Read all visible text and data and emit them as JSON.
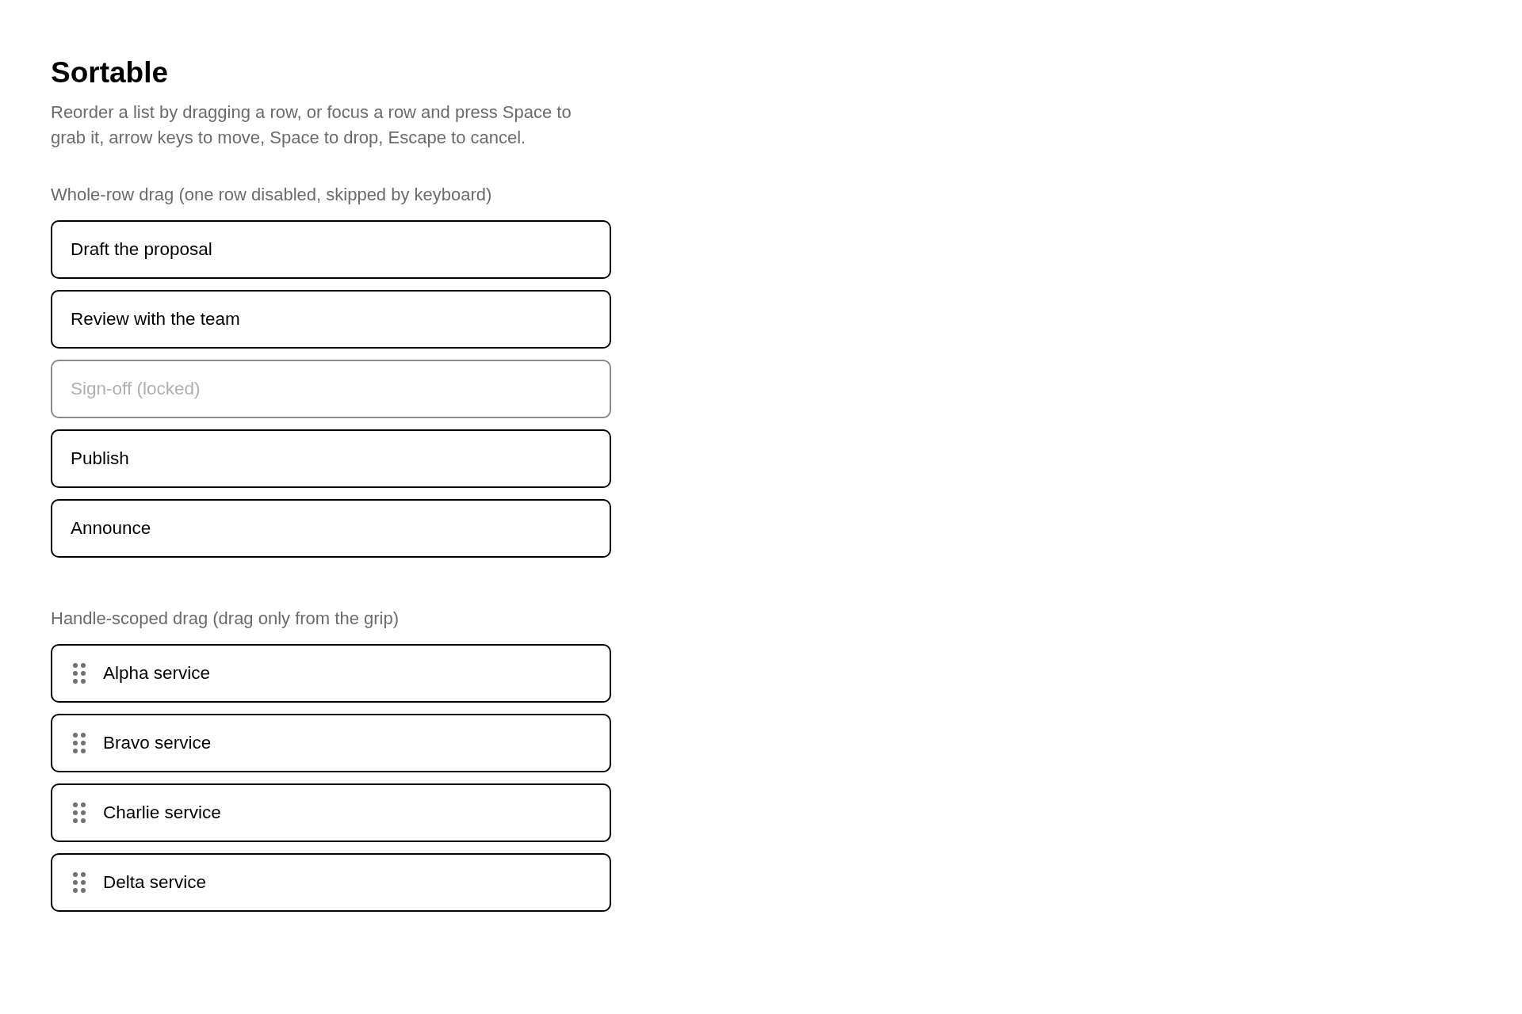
{
  "title": "Sortable",
  "description": "Reorder a list by dragging a row, or focus a row and press Space to grab it, arrow keys to move, Space to drop, Escape to cancel.",
  "lists": [
    {
      "kind": "whole-row",
      "label": "Whole-row drag (one row disabled, skipped by keyboard)",
      "items": [
        {
          "label": "Draft the proposal",
          "disabled": false
        },
        {
          "label": "Review with the team",
          "disabled": false
        },
        {
          "label": "Sign-off (locked)",
          "disabled": true
        },
        {
          "label": "Publish",
          "disabled": false
        },
        {
          "label": "Announce",
          "disabled": false
        }
      ]
    },
    {
      "kind": "handle",
      "label": "Handle-scoped drag (drag only from the grip)",
      "items": [
        {
          "label": "Alpha service",
          "disabled": false
        },
        {
          "label": "Bravo service",
          "disabled": false
        },
        {
          "label": "Charlie service",
          "disabled": false
        },
        {
          "label": "Delta service",
          "disabled": false
        }
      ]
    }
  ]
}
